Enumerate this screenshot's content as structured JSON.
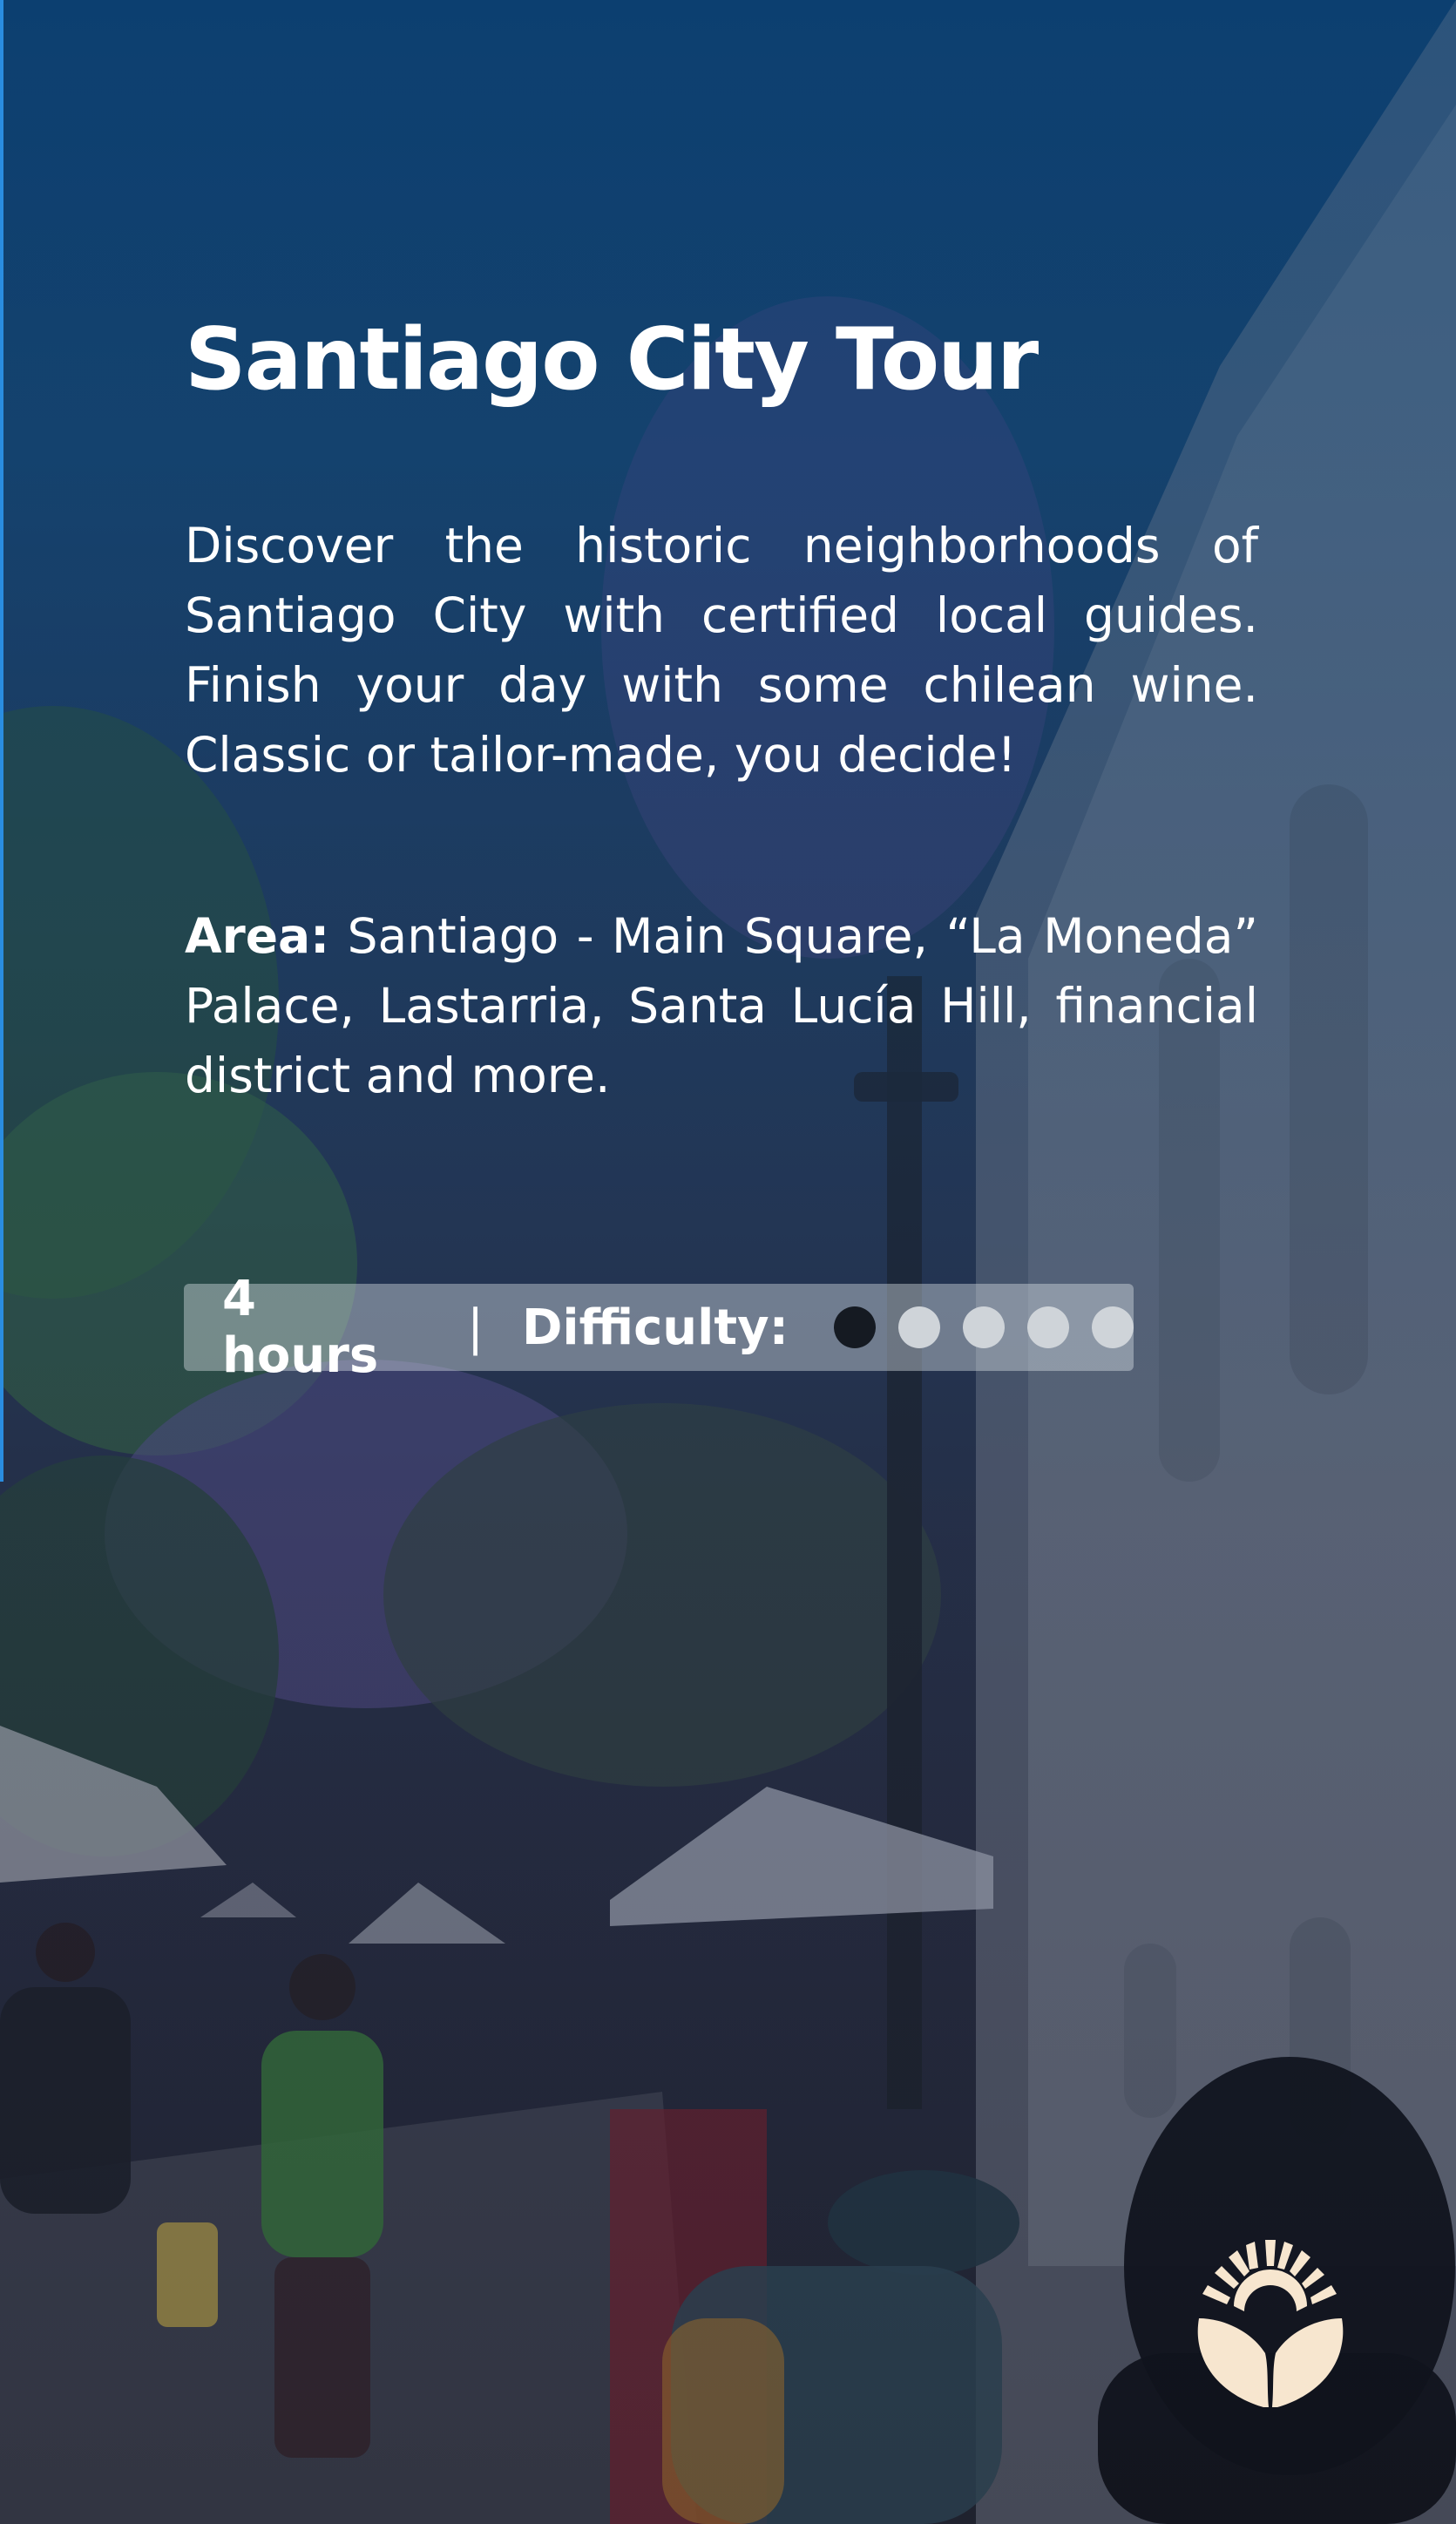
{
  "tour": {
    "title": "Santiago City Tour",
    "description": "Discover the historic neighborhoods of Santiago City with certified local guides. Finish your day with some chilean wine. Classic or tailor-made, you decide!",
    "area_label": "Area:",
    "area_text": " Santiago - Main Square, “La Moneda” Palace, Lastarria, Santa Lucía Hill, financial district and more.",
    "duration": "4 hours",
    "separator": "|",
    "difficulty_label": "Difficulty:",
    "difficulty_level": 1,
    "difficulty_max": 5
  },
  "colors": {
    "dot_filled": "#151a22",
    "dot_empty": "#cfd4d9",
    "logo_fill": "#f7e6cf"
  },
  "logo": {
    "icon": "sun-and-hands-logo-icon"
  }
}
